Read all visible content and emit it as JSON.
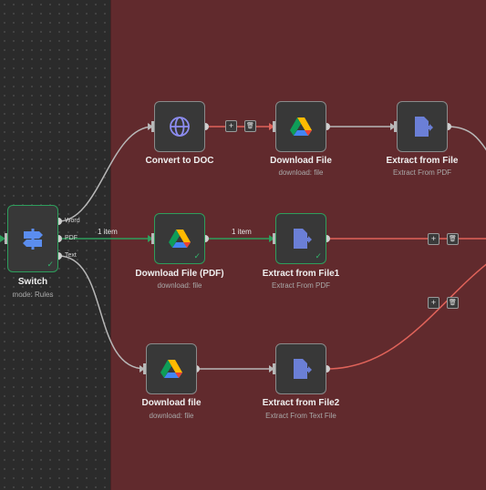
{
  "nodes": {
    "switch": {
      "title": "Switch",
      "subtitle": "mode: Rules",
      "outputs": [
        "Word",
        "PDF",
        "Text"
      ]
    },
    "convert_to_doc": {
      "title": "Convert to DOC",
      "subtitle": ""
    },
    "download_file": {
      "title": "Download File",
      "subtitle": "download: file"
    },
    "extract_from_file": {
      "title": "Extract from File",
      "subtitle": "Extract From PDF"
    },
    "download_file_pdf": {
      "title": "Download File (PDF)",
      "subtitle": "download: file"
    },
    "extract_from_file1": {
      "title": "Extract from File1",
      "subtitle": "Extract From PDF"
    },
    "download_file_lower": {
      "title": "Download file",
      "subtitle": "download: file"
    },
    "extract_from_file2": {
      "title": "Extract from File2",
      "subtitle": "Extract From Text File"
    }
  },
  "edge_labels": {
    "switch_to_pdf": "1 item",
    "pdf_to_extract1": "1 item"
  },
  "edge_actions": {
    "add": "+",
    "delete": "🗑"
  },
  "icons": {
    "switch": "signpost-icon",
    "convert_to_doc": "globe-icon",
    "google_drive": "google-drive-icon",
    "extract": "file-export-icon",
    "success": "check-icon"
  },
  "colors": {
    "canvas_bg": "#2b2b2b",
    "sticky_bg": "#612a2d",
    "edge_default": "#b8b8b8",
    "edge_success": "#2e9e5c",
    "edge_error": "#e0635a",
    "node_bg": "#383838",
    "node_border": "#8a8a8a",
    "success_border": "#2e9e5c"
  },
  "check_mark": "✓"
}
